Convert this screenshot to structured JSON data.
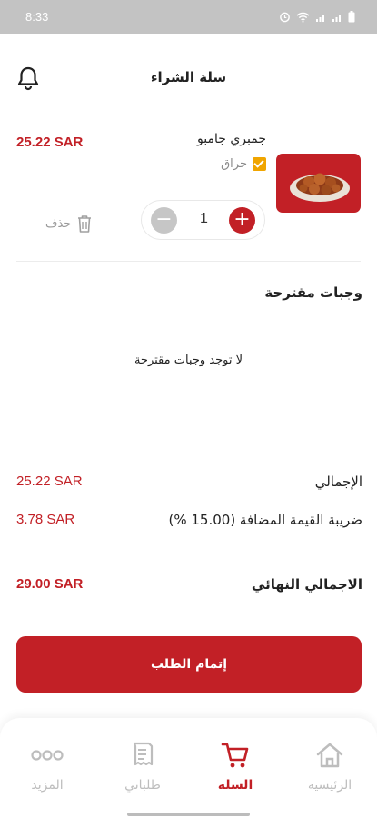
{
  "status_bar": {
    "time": "8:33",
    "icons": [
      "alarm-icon",
      "wifi-icon",
      "signal-icon",
      "signal-icon",
      "battery-icon"
    ]
  },
  "header": {
    "title": "سلة الشراء",
    "icon": "bell-icon"
  },
  "cart_item": {
    "name": "جمبري جامبو",
    "price": "25.22 SAR",
    "option_label": "حراق",
    "option_checked": true,
    "quantity": "1",
    "minus_symbol": "−",
    "plus_symbol": "+",
    "delete_label": "حذف"
  },
  "suggested": {
    "title": "وجبات مقترحة",
    "empty_message": "لا توجد وجبات مقترحة"
  },
  "summary": {
    "subtotal_label": "الإجمالي",
    "subtotal_value": "25.22 SAR",
    "vat_label": "ضريبة القيمة المضافة (15.00 %)",
    "vat_value": "3.78 SAR",
    "total_label": "الاجمالي النهائي",
    "total_value": "29.00 SAR"
  },
  "checkout_button": "إتمام الطلب",
  "bottom_nav": {
    "items": [
      {
        "label": "الرئيسية",
        "icon": "home-icon",
        "active": false
      },
      {
        "label": "السلة",
        "icon": "cart-icon",
        "active": true
      },
      {
        "label": "طلباتي",
        "icon": "receipt-icon",
        "active": false
      },
      {
        "label": "المزيد",
        "icon": "more-icon",
        "active": false
      }
    ]
  },
  "colors": {
    "accent": "#c22026",
    "checkbox": "#f0a500",
    "status_bar": "#c3c3c3",
    "inactive": "#bdbdbd"
  }
}
